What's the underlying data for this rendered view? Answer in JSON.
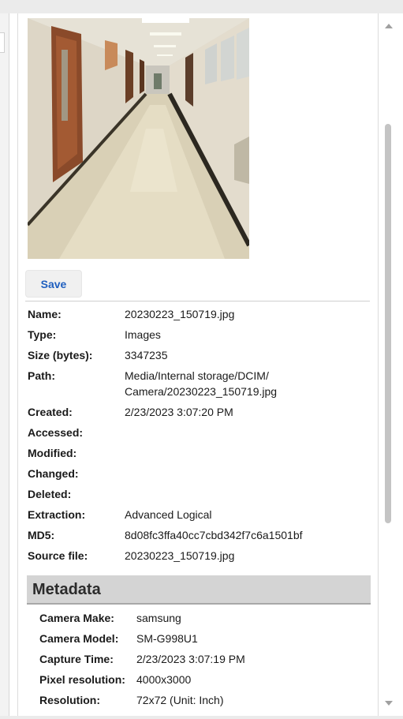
{
  "file": {
    "save_label": "Save",
    "properties": [
      {
        "label": "Name:",
        "value": "20230223_150719.jpg"
      },
      {
        "label": "Type:",
        "value": "Images"
      },
      {
        "label": "Size (bytes):",
        "value": "3347235"
      },
      {
        "label": "Path:",
        "value": "Media/Internal storage/DCIM/\nCamera/20230223_150719.jpg"
      },
      {
        "label": "Created:",
        "value": "2/23/2023 3:07:20 PM"
      },
      {
        "label": "Accessed:",
        "value": ""
      },
      {
        "label": "Modified:",
        "value": ""
      },
      {
        "label": "Changed:",
        "value": ""
      },
      {
        "label": "Deleted:",
        "value": ""
      },
      {
        "label": "Extraction:",
        "value": "Advanced Logical"
      },
      {
        "label": "MD5:",
        "value": "8d08fc3ffa40cc7cbd342f7c6a1501bf"
      },
      {
        "label": "Source file:",
        "value": "20230223_150719.jpg"
      }
    ]
  },
  "metadata": {
    "title": "Metadata",
    "rows": [
      {
        "label": "Camera Make:",
        "value": "samsung"
      },
      {
        "label": "Camera Model:",
        "value": "SM-G998U1"
      },
      {
        "label": "Capture Time:",
        "value": "2/23/2023 3:07:19 PM"
      },
      {
        "label": "Pixel resolution:",
        "value": "4000x3000"
      },
      {
        "label": "Resolution:",
        "value": "72x72 (Unit: Inch)"
      }
    ]
  },
  "colors": {
    "accent": "#1f5fbf",
    "header_bg": "#d4d4d4"
  },
  "icons": {
    "scroll_up": "scroll-up-arrow-icon",
    "scroll_down": "scroll-down-arrow-icon"
  }
}
